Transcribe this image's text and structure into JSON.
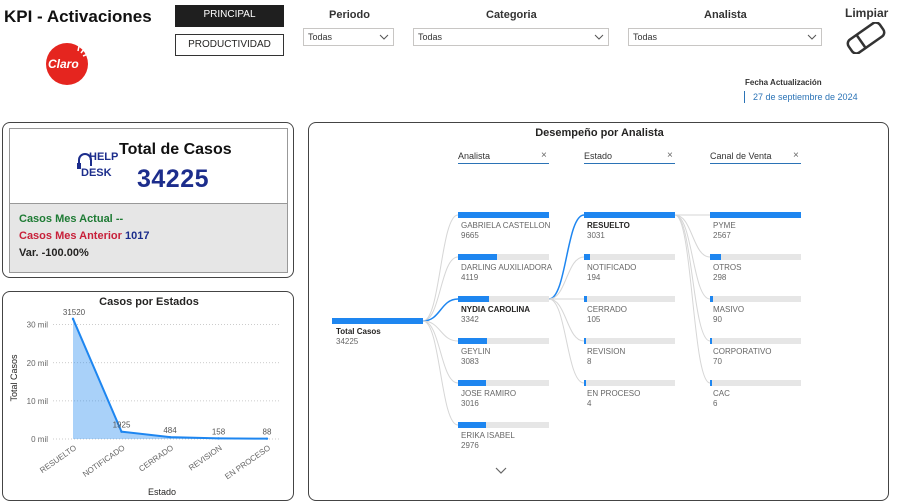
{
  "app": {
    "title": "KPI - Activaciones",
    "logo_text": "Claro"
  },
  "nav": {
    "principal": "PRINCIPAL",
    "productividad": "PRODUCTIVIDAD"
  },
  "filters": {
    "periodo": {
      "label": "Periodo",
      "value": "Todas"
    },
    "categoria": {
      "label": "Categoria",
      "value": "Todas"
    },
    "analista": {
      "label": "Analista",
      "value": "Todas"
    }
  },
  "limpiar": {
    "label": "Limpiar",
    "icon": "eraser-icon"
  },
  "fecha": {
    "label": "Fecha Actualización",
    "value": "27 de septiembre de 2024"
  },
  "total_card": {
    "logo_text_top": "HELP",
    "logo_text_bottom": "DESK",
    "label": "Total de Casos",
    "value": "34225",
    "mes_actual_label": "Casos Mes Actual",
    "mes_actual_value": "--",
    "mes_anterior_label": "Casos Mes Anterior",
    "mes_anterior_value": "1017",
    "var_label": "Var.",
    "var_value": "-100.00%"
  },
  "estados_chart": {
    "title": "Casos por Estados",
    "chart_data": {
      "type": "area",
      "title": "Casos por Estados",
      "xlabel": "Estado",
      "ylabel": "Total Casos",
      "categories": [
        "RESUELTO",
        "NOTIFICADO",
        "CERRADO",
        "REVISION",
        "EN PROCESO"
      ],
      "values": [
        31520,
        1925,
        484,
        158,
        88
      ],
      "data_labels": [
        "31520",
        "1925",
        "484",
        "158",
        "88"
      ],
      "y_ticks": [
        0,
        10000,
        20000,
        30000
      ],
      "y_tick_labels": [
        "0 mil",
        "10 mil",
        "20 mil",
        "30 mil"
      ],
      "ylim": [
        0,
        32000
      ],
      "grid": true,
      "color": "#1e86f0"
    }
  },
  "decomp": {
    "title": "Desempeño por Analista",
    "columns": [
      "Analista",
      "Estado",
      "Canal de Venta"
    ],
    "root": {
      "label": "Total Casos",
      "value": "34225",
      "amount": 34225
    },
    "analistas": [
      {
        "label": "GABRIELA CASTELLON",
        "value": "9665",
        "amount": 9665,
        "selected": false
      },
      {
        "label": "DARLING AUXILIADORA",
        "value": "4119",
        "amount": 4119,
        "selected": false
      },
      {
        "label": "NYDIA CAROLINA",
        "value": "3342",
        "amount": 3342,
        "selected": true
      },
      {
        "label": "GEYLIN",
        "value": "3083",
        "amount": 3083,
        "selected": false
      },
      {
        "label": "JOSE RAMIRO",
        "value": "3016",
        "amount": 3016,
        "selected": false
      },
      {
        "label": "ERIKA ISABEL",
        "value": "2976",
        "amount": 2976,
        "selected": false
      }
    ],
    "estados": [
      {
        "label": "RESUELTO",
        "value": "3031",
        "amount": 3031,
        "selected": true
      },
      {
        "label": "NOTIFICADO",
        "value": "194",
        "amount": 194,
        "selected": false
      },
      {
        "label": "CERRADO",
        "value": "105",
        "amount": 105,
        "selected": false
      },
      {
        "label": "REVISION",
        "value": "8",
        "amount": 8,
        "selected": false
      },
      {
        "label": "EN PROCESO",
        "value": "4",
        "amount": 4,
        "selected": false
      }
    ],
    "canales": [
      {
        "label": "PYME",
        "value": "2567",
        "amount": 2567,
        "selected": false
      },
      {
        "label": "OTROS",
        "value": "298",
        "amount": 298,
        "selected": false
      },
      {
        "label": "MASIVO",
        "value": "90",
        "amount": 90,
        "selected": false
      },
      {
        "label": "CORPORATIVO",
        "value": "70",
        "amount": 70,
        "selected": false
      },
      {
        "label": "CAC",
        "value": "6",
        "amount": 6,
        "selected": false
      }
    ],
    "colors": {
      "bar": "#1e86f0",
      "track": "#e6e6e6",
      "link": "#1e86f0"
    }
  }
}
